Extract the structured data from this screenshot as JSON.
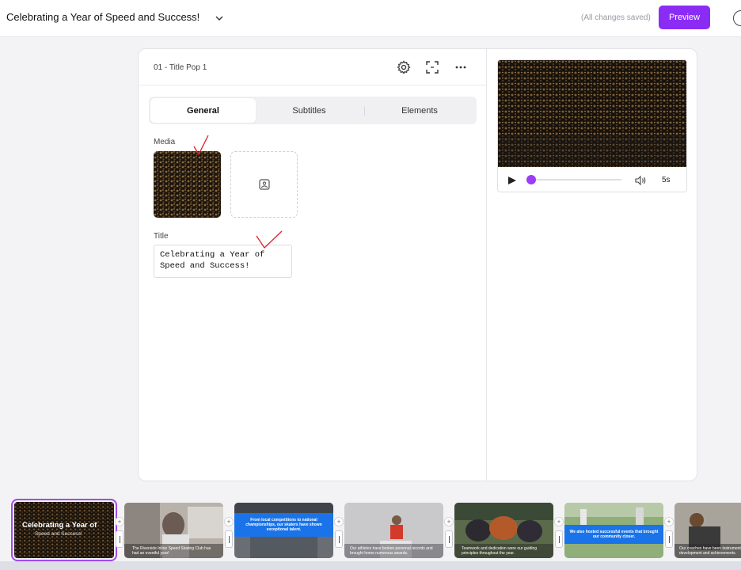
{
  "header": {
    "project_title": "Celebrating a Year of Speed and Success!",
    "saved_status": "(All changes saved)",
    "preview_label": "Preview",
    "brand_color": "#8b2cf5"
  },
  "editor": {
    "scene_name": "01 - Title Pop 1",
    "tabs": [
      {
        "label": "General",
        "active": true
      },
      {
        "label": "Subtitles",
        "active": false
      },
      {
        "label": "Elements",
        "active": false
      }
    ],
    "media_label": "Media",
    "title_label": "Title",
    "title_value": "Celebrating a Year of\nSpeed and Success!",
    "icons": [
      "gear-icon",
      "expand-icon",
      "more-icon",
      "image-add-icon"
    ]
  },
  "player": {
    "duration": "5s",
    "progress": 0.0
  },
  "timeline": {
    "scenes": [
      {
        "title": "Celebrating a Year of",
        "caption": "Speed and Success!",
        "selected": true
      },
      {
        "caption": "The Riverside Inline Speed Skating Club has had an eventful year!"
      },
      {
        "caption": "From local competitions to national championships, our skaters have shown exceptional talent."
      },
      {
        "caption": "Our athletes have broken personal records and brought home numerous awards."
      },
      {
        "caption": "Teamwork and dedication were our guiding principles throughout the year."
      },
      {
        "caption": "We also hosted successful events that brought our community closer."
      },
      {
        "caption": "Our coaches have been instrumental in our skaters' development and achievements."
      }
    ]
  }
}
